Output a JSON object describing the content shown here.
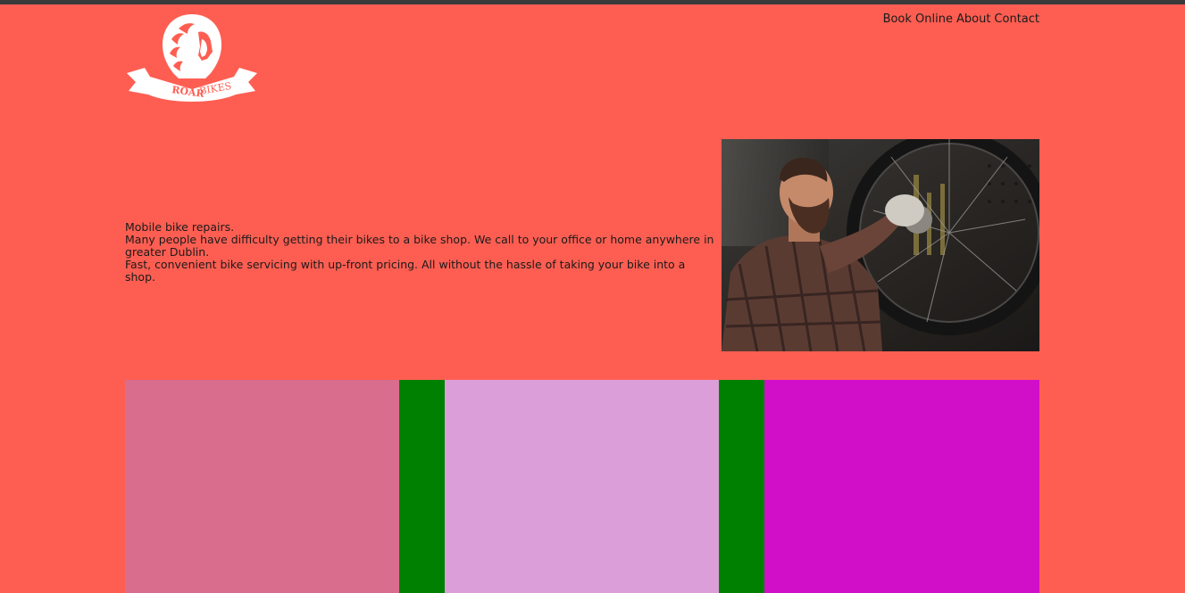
{
  "brand": {
    "logo_text_roar": "ROAR",
    "logo_text_bikes": "BIKES"
  },
  "nav": {
    "items": [
      "Book Online",
      "About",
      "Contact"
    ]
  },
  "intro": {
    "line1": "Mobile bike repairs.",
    "line2": "Many people have difficulty getting their bikes to a bike shop. We call to your office or home anywhere in greater Dublin.",
    "line3": "Fast, convenient bike servicing with up-front pricing. All without the hassle of taking your bike into a shop."
  },
  "colors": {
    "background": "#fe5e52",
    "block_1": "#d96d8e",
    "gutter": "#008000",
    "block_2": "#db9ed9",
    "block_3": "#d10fc9"
  }
}
